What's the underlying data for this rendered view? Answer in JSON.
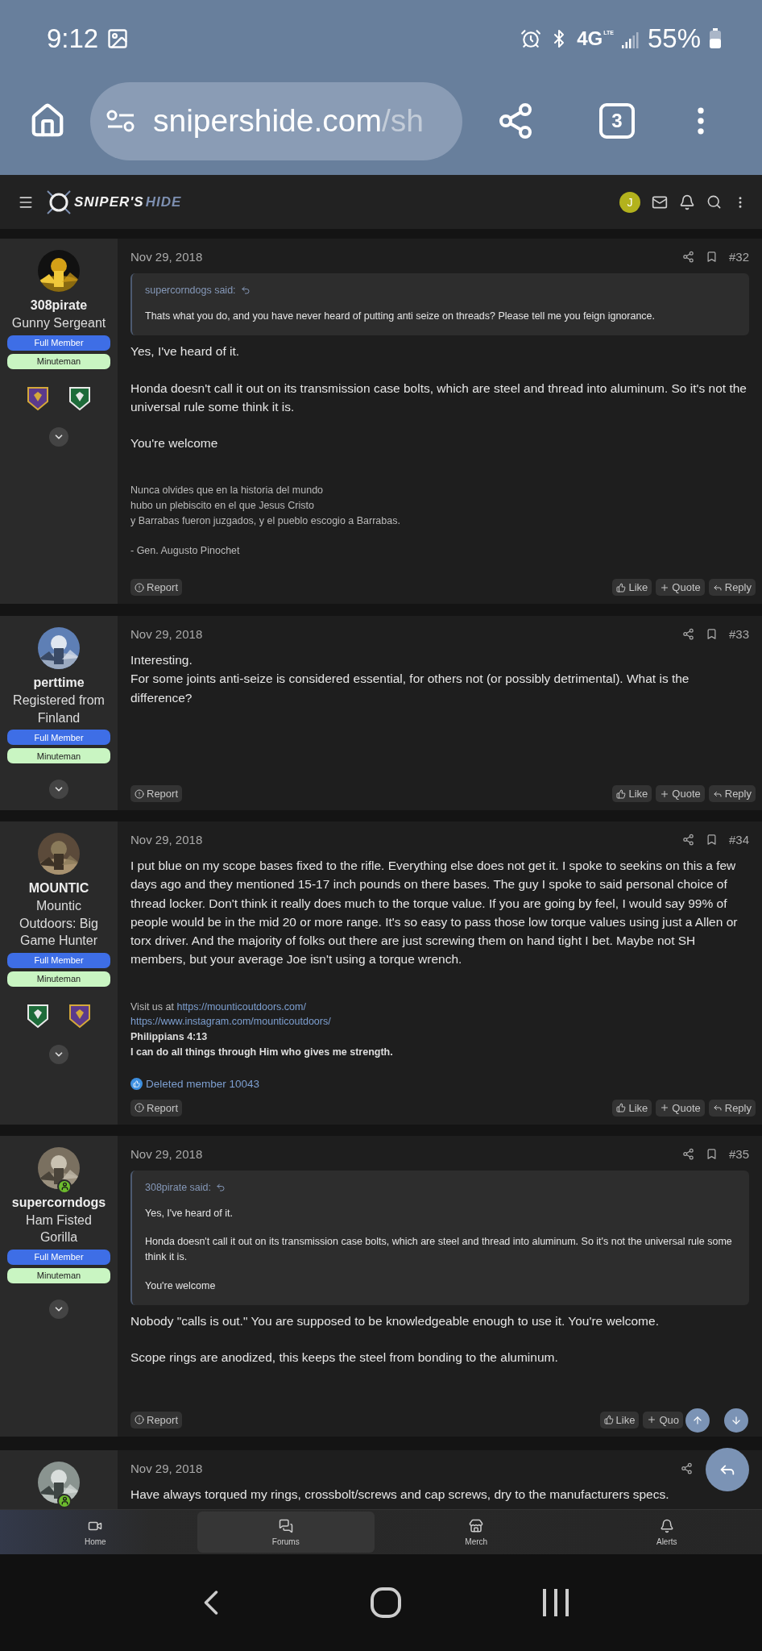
{
  "status_bar": {
    "time": "9:12",
    "network": "4G",
    "network_sub": "LTE",
    "battery": "55%"
  },
  "browser": {
    "url_host": "snipershide.com",
    "url_path": "/sh",
    "tab_count": "3"
  },
  "site_header": {
    "logo": [
      "SNIPER'S",
      "HIDE"
    ],
    "user_initial": "J"
  },
  "posts": [
    {
      "user": {
        "name": "308pirate",
        "title": "Gunny Sergeant",
        "online": false,
        "banners": [
          {
            "label": "Full Member",
            "kind": "primary"
          },
          {
            "label": "Minuteman",
            "kind": "secondary"
          }
        ],
        "awards": [
          {
            "kind": "purple"
          },
          {
            "kind": "green"
          }
        ]
      },
      "date": "Nov 29, 2018",
      "bookmark": true,
      "number": "#32",
      "quote": {
        "author": "supercorndogs said:",
        "blocks": [
          [
            "Thats what you do, and you have never heard of putting anti seize on threads? Please tell me you feign ignorance."
          ]
        ]
      },
      "body": [
        [
          "Yes, I've heard of it."
        ],
        [
          "Honda doesn't call it out on its transmission case bolts, which are steel and thread into aluminum. So it's not the universal rule some think it is."
        ],
        [
          "You're welcome"
        ]
      ],
      "signature": [
        [
          [
            {
              "kind": "text",
              "text": "Nunca olvides que en la historia del mundo"
            }
          ],
          [
            {
              "kind": "text",
              "text": "hubo un plebiscito en el que Jesus Cristo"
            }
          ],
          [
            {
              "kind": "text",
              "text": "y Barrabas fueron juzgados, y el pueblo escogio a Barrabas."
            }
          ]
        ],
        [
          [
            {
              "kind": "text",
              "text": "- Gen. Augusto Pinochet"
            }
          ]
        ]
      ],
      "actions": [
        {
          "kind": "report",
          "label": "Report"
        },
        {
          "kind": "like",
          "label": "Like"
        },
        {
          "kind": "quote",
          "label": "Quote"
        },
        {
          "kind": "reply",
          "label": "Reply"
        }
      ]
    },
    {
      "user": {
        "name": "perttime",
        "title": "Registered from Finland",
        "online": false,
        "banners": [
          {
            "label": "Full Member",
            "kind": "primary"
          },
          {
            "label": "Minuteman",
            "kind": "secondary"
          }
        ]
      },
      "date": "Nov 29, 2018",
      "bookmark": true,
      "number": "#33",
      "body": [
        [
          "Interesting.",
          "For some joints anti-seize is considered essential, for others not (or possibly detrimental). What is the difference?"
        ]
      ],
      "actions": [
        {
          "kind": "report",
          "label": "Report"
        },
        {
          "kind": "like",
          "label": "Like"
        },
        {
          "kind": "quote",
          "label": "Quote"
        },
        {
          "kind": "reply",
          "label": "Reply"
        }
      ]
    },
    {
      "user": {
        "name": "MOUNTIC",
        "title": "Mountic Outdoors: Big Game Hunter",
        "online": false,
        "banners": [
          {
            "label": "Full Member",
            "kind": "primary"
          },
          {
            "label": "Minuteman",
            "kind": "secondary"
          }
        ],
        "awards": [
          {
            "kind": "green"
          },
          {
            "kind": "purple"
          }
        ]
      },
      "date": "Nov 29, 2018",
      "bookmark": true,
      "number": "#34",
      "body": [
        [
          "I put blue on my scope bases fixed to the rifle. Everything else does not get it. I spoke to seekins on this a few days ago and they mentioned 15-17 inch pounds on there bases. The guy I spoke to said personal choice of thread locker. Don't think it really does much to the torque value. If you are going by feel, I would say 99% of people would be in the mid 20 or more range. It's so easy to pass those low torque values using just a Allen or torx driver. And the majority of folks out there are just screwing them on hand tight I bet. Maybe not SH members, but your average Joe isn't using a torque wrench."
        ]
      ],
      "signature": [
        [
          [
            {
              "kind": "text",
              "text": "Visit us at "
            },
            {
              "kind": "link",
              "text": "https://mounticoutdoors.com/"
            }
          ],
          [
            {
              "kind": "link",
              "text": "https://www.instagram.com/mounticoutdoors/"
            }
          ],
          [
            {
              "kind": "bold",
              "text": "Philippians 4:13"
            }
          ],
          [
            {
              "kind": "bold",
              "text": "I can do all things through Him who gives me strength."
            }
          ]
        ]
      ],
      "reaction": "Deleted member 10043",
      "actions": [
        {
          "kind": "report",
          "label": "Report"
        },
        {
          "kind": "like",
          "label": "Like"
        },
        {
          "kind": "quote",
          "label": "Quote"
        },
        {
          "kind": "reply",
          "label": "Reply"
        }
      ]
    },
    {
      "user": {
        "name": "supercorndogs",
        "title": "Ham Fisted Gorilla",
        "online": true,
        "banners": [
          {
            "label": "Full Member",
            "kind": "primary"
          },
          {
            "label": "Minuteman",
            "kind": "secondary"
          }
        ]
      },
      "date": "Nov 29, 2018",
      "bookmark": true,
      "number": "#35",
      "quote": {
        "author": "308pirate said:",
        "blocks": [
          [
            "Yes, I've heard of it."
          ],
          [
            "Honda doesn't call it out on its transmission case bolts, which are steel and thread into aluminum. So it's not the universal rule some think it is."
          ],
          [
            "You're welcome"
          ]
        ]
      },
      "body": [
        [
          "Nobody \"calls is out.\" You are supposed to be knowledgeable enough to use it. You're welcome."
        ],
        [
          "Scope rings are anodized, this keeps the steel from bonding to the aluminum."
        ]
      ],
      "actions": [
        {
          "kind": "report",
          "label": "Report"
        },
        {
          "kind": "like",
          "label": "Like"
        },
        {
          "kind": "quote",
          "label": "Quo"
        }
      ]
    },
    {
      "user": {
        "online": true
      },
      "date": "Nov 29, 2018",
      "bookmark": false,
      "body": [
        [
          "Have always torqued my rings, crossbolt/screws and cap screws, dry to the manufacturers specs."
        ]
      ]
    }
  ],
  "bottom_nav": [
    {
      "kind": "video",
      "label": "Home",
      "selected": false
    },
    {
      "kind": "forums",
      "label": "Forums",
      "selected": true
    },
    {
      "kind": "store",
      "label": "Merch",
      "selected": false
    },
    {
      "kind": "bell",
      "label": "Alerts",
      "selected": false
    }
  ]
}
